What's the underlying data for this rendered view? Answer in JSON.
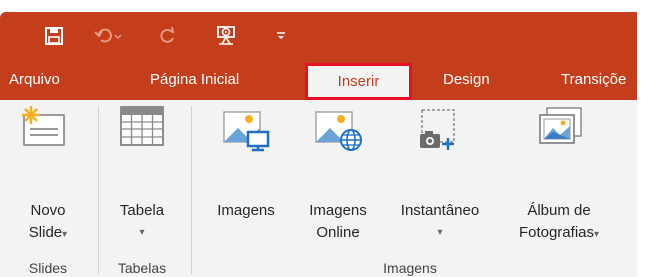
{
  "qat": {
    "icons": [
      "save-icon",
      "undo-icon",
      "redo-icon",
      "presentation-from-start-icon",
      "customize-qat-icon"
    ]
  },
  "tabs": [
    {
      "label": "Arquivo"
    },
    {
      "label": "Página Inicial"
    },
    {
      "label": "Inserir",
      "active": true
    },
    {
      "label": "Design"
    },
    {
      "label": "Transiçõe"
    }
  ],
  "groups": {
    "slides": {
      "label": "Slides",
      "new_slide": {
        "line1": "Novo",
        "line2": "Slide",
        "dropdown": "▾",
        "icon": "new-slide-icon"
      }
    },
    "tables": {
      "label": "Tabelas",
      "table": {
        "line1": "Tabela",
        "dropdown": "▾",
        "icon": "table-icon"
      }
    },
    "images": {
      "label": "Imagens",
      "images": {
        "line1": "Imagens",
        "icon": "picture-icon"
      },
      "online_images": {
        "line1": "Imagens",
        "line2": "Online",
        "icon": "online-picture-icon"
      },
      "screenshot": {
        "line1": "Instantâneo",
        "dropdown": "▾",
        "icon": "screenshot-icon"
      },
      "photo_album": {
        "line1": "Álbum de",
        "line2": "Fotografias",
        "dropdown": "▾",
        "icon": "photo-album-icon"
      }
    }
  },
  "colors": {
    "accent": "#c43e1c",
    "highlight": "#e81123",
    "ribbon_bg": "#f3f3f3"
  }
}
